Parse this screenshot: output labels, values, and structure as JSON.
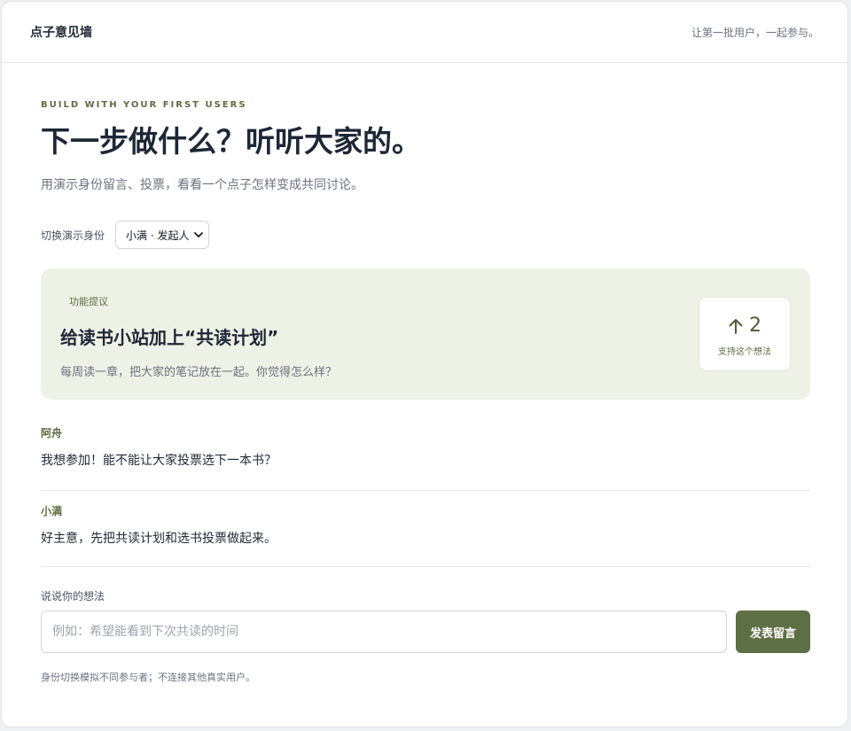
{
  "header": {
    "brand": "点子意见墙",
    "tagline": "让第一批用户，一起参与。"
  },
  "hero": {
    "eyebrow": "BUILD WITH YOUR FIRST USERS",
    "title": "下一步做什么？听听大家的。",
    "subtitle": "用演示身份留言、投票，看看一个点子怎样变成共同讨论。"
  },
  "identity": {
    "label": "切换演示身份",
    "selected": "小满 · 发起人"
  },
  "proposal": {
    "tag": "功能提议",
    "title": "给读书小站加上“共读计划”",
    "description": "每周读一章，把大家的笔记放在一起。你觉得怎么样？",
    "vote_count": "2",
    "vote_label": "支持这个想法"
  },
  "comments": [
    {
      "author": "阿舟",
      "text": "我想参加！能不能让大家投票选下一本书？"
    },
    {
      "author": "小满",
      "text": "好主意，先把共读计划和选书投票做起来。"
    }
  ],
  "compose": {
    "label": "说说你的想法",
    "placeholder": "例如：希望能看到下次共读的时间",
    "value": "",
    "submit_label": "发表留言"
  },
  "footnote": "身份切换模拟不同参与者；不连接其他真实用户。",
  "colors": {
    "accent": "#5d7045",
    "accent_text": "#5b6e3f",
    "proposal_bg": "#eef1e6"
  }
}
